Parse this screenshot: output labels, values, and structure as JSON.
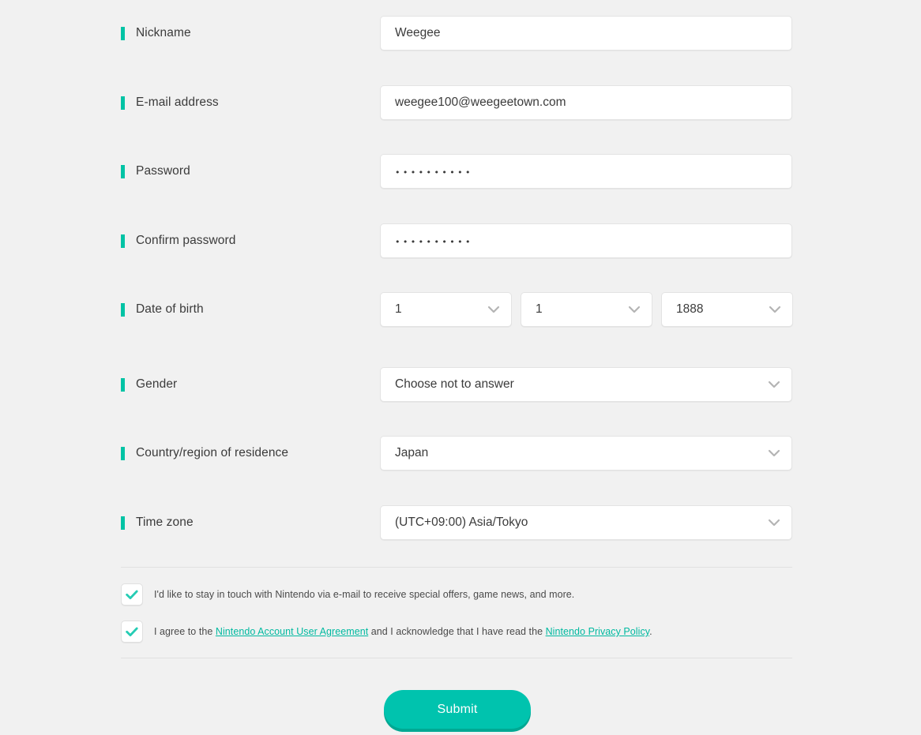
{
  "form": {
    "fields": [
      {
        "name": "nickname",
        "label": "Nickname",
        "value": "Weegee",
        "type": "text"
      },
      {
        "name": "email",
        "label": "E-mail address",
        "value": "weegee100@weegeetown.com",
        "type": "text"
      },
      {
        "name": "password",
        "label": "Password",
        "value": "••••••••••",
        "type": "password"
      },
      {
        "name": "confirm",
        "label": "Confirm password",
        "value": "••••••••••",
        "type": "password"
      },
      {
        "name": "dob",
        "label": "Date of birth",
        "type": "date-group"
      },
      {
        "name": "gender",
        "label": "Gender",
        "value": "Choose not to answer",
        "type": "select"
      },
      {
        "name": "country",
        "label": "Country/region of residence",
        "value": "Japan",
        "type": "select"
      },
      {
        "name": "timezone",
        "label": "Time zone",
        "value": "(UTC+09:00) Asia/Tokyo",
        "type": "select"
      }
    ],
    "date_of_birth": {
      "month": "1",
      "day": "1",
      "year": "1888"
    },
    "checkboxes": [
      {
        "name": "newsletter",
        "checked": true,
        "text": "I'd like to stay in touch with Nintendo via e-mail to receive special offers, game news, and more."
      },
      {
        "name": "agreement",
        "checked": true,
        "text_before": "I agree to the ",
        "link1": "Nintendo Account User Agreement",
        "text_middle": " and I acknowledge that I have read the ",
        "link2": "Nintendo Privacy Policy",
        "text_after": "."
      }
    ],
    "submit_label": "Submit",
    "icons": {
      "chevron": "chevron-down-icon",
      "check": "check-icon",
      "required": "required-marker"
    }
  },
  "colors": {
    "accent": "#00c3a5",
    "accent_button": "#00c3ae",
    "accent_button_shadow": "#00a893",
    "link": "#00b9a0",
    "background": "#f1f1f1",
    "field_background": "#ffffff",
    "field_border": "#e3e3e3",
    "text": "#3b3b3b",
    "chevron": "#b4b4b4"
  }
}
